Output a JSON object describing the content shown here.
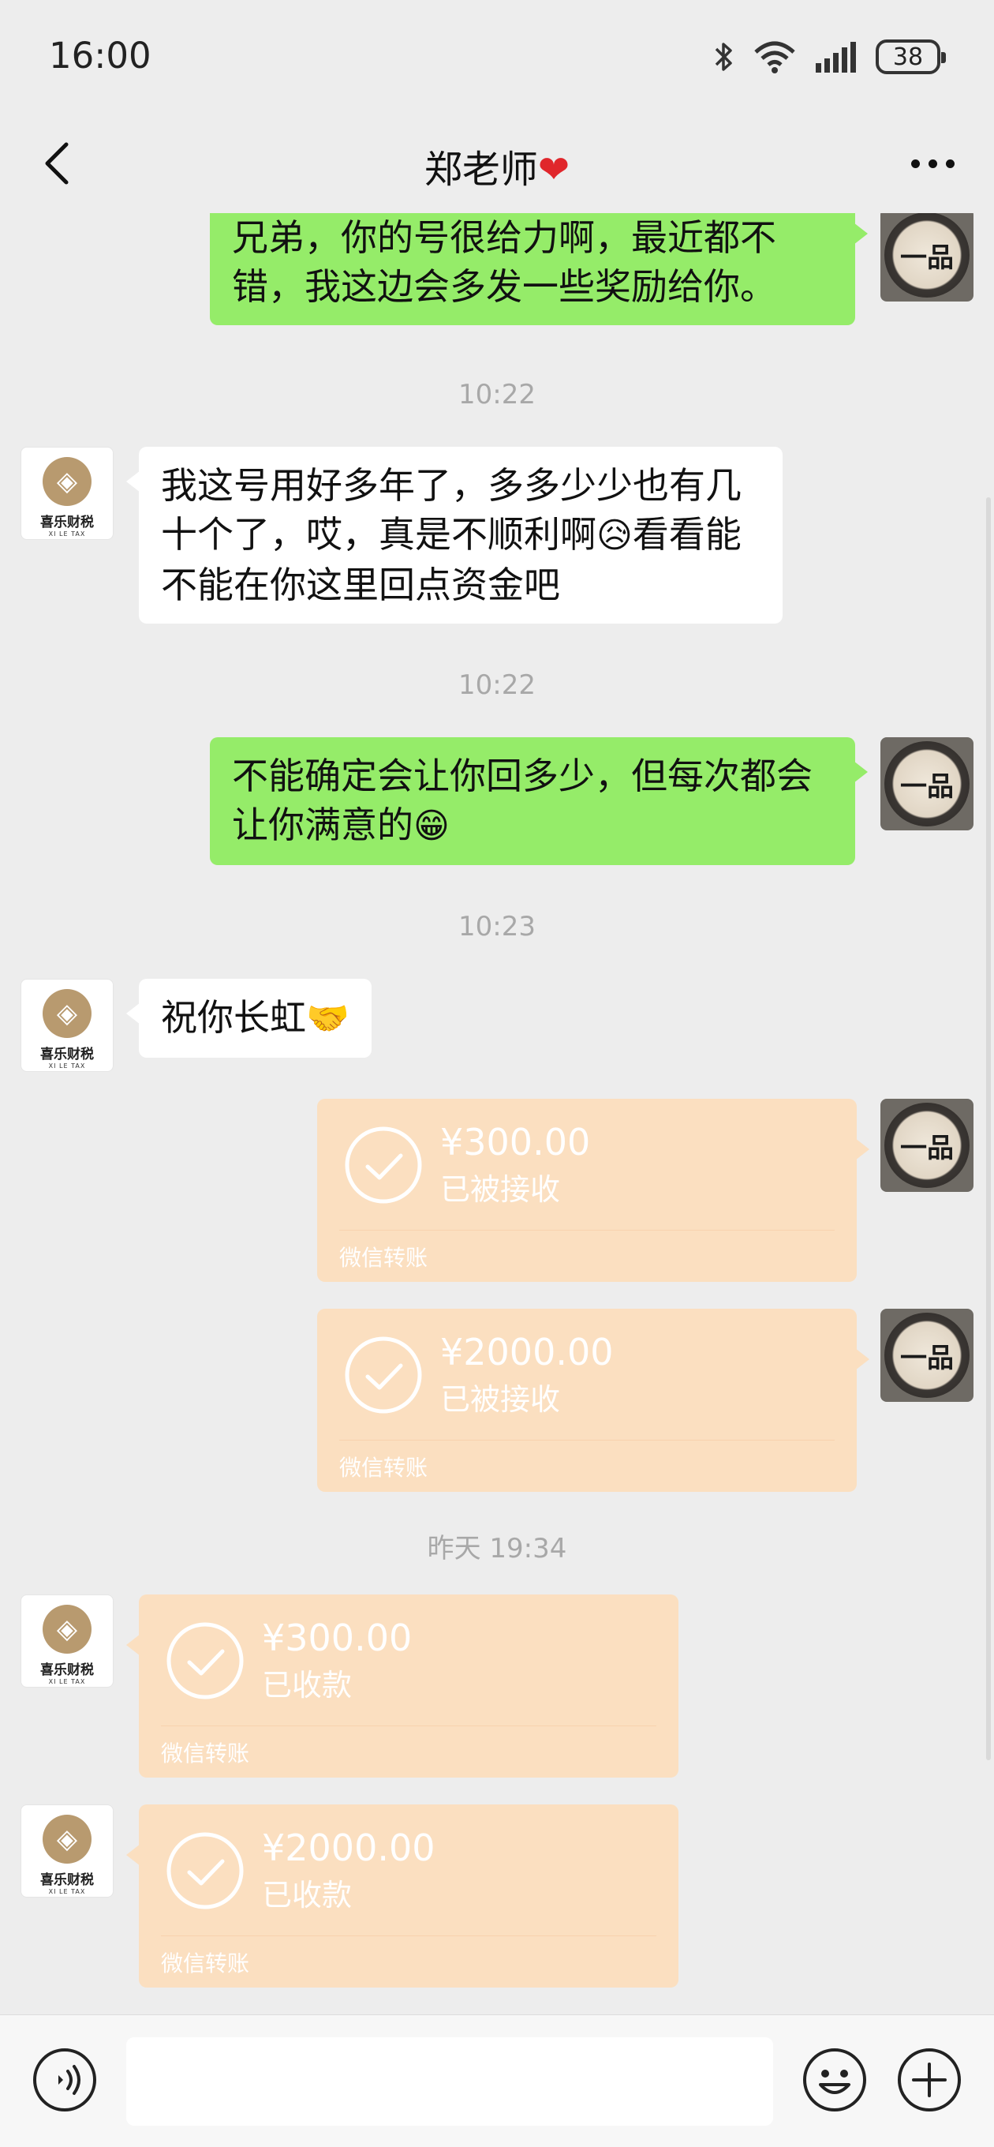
{
  "status_bar": {
    "time": "16:00",
    "battery": "38"
  },
  "nav": {
    "title": "郑老师",
    "title_emoji": "❤"
  },
  "messages": [
    {
      "text": "兄弟，你的号很给力啊，最近都不错，我这边会多发一些奖励给你。"
    },
    {
      "time": "10:22"
    },
    {
      "text": "我这号用好多年了，多多少少也有几十个了，哎，真是不顺利啊",
      "emoji": "😥",
      "text_after": "看看能不能在你这里回点资金吧"
    },
    {
      "time": "10:22"
    },
    {
      "text": "不能确定会让你回多少，但每次都会让你满意的",
      "emoji": "😁"
    },
    {
      "time": "10:23"
    },
    {
      "text": "祝你长虹",
      "emoji": "🤝"
    }
  ],
  "transfers": [
    {
      "amount": "¥300.00",
      "status": "已被接收",
      "source": "微信转账"
    },
    {
      "amount": "¥2000.00",
      "status": "已被接收",
      "source": "微信转账"
    },
    {
      "time": "昨天 19:34"
    },
    {
      "amount": "¥300.00",
      "status": "已收款",
      "source": "微信转账"
    },
    {
      "amount": "¥2000.00",
      "status": "已收款",
      "source": "微信转账"
    }
  ],
  "avatars": {
    "me_char": "一品",
    "other_logo_cn": "喜乐财税",
    "other_logo_en": "XI LE TAX"
  },
  "input": {
    "placeholder": ""
  },
  "icons": [
    "back-icon",
    "more-icon",
    "voice-icon",
    "emoji-icon",
    "plus-icon",
    "check-icon",
    "bluetooth-icon",
    "wifi-icon",
    "signal-icon",
    "battery-icon"
  ]
}
